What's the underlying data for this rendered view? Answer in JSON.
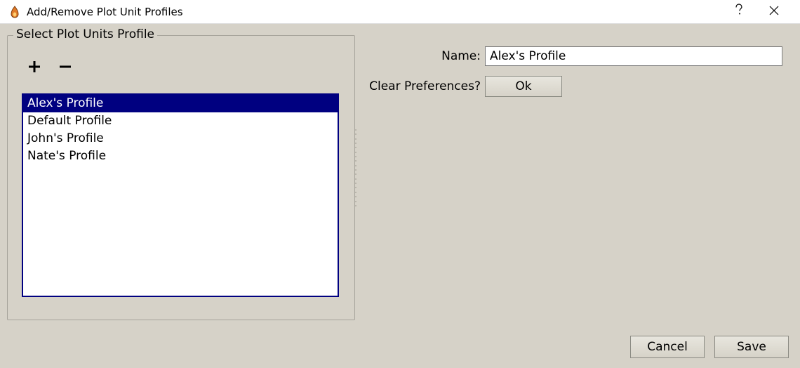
{
  "window": {
    "title": "Add/Remove Plot Unit Profiles"
  },
  "groupbox": {
    "title": "Select Plot Units Profile"
  },
  "profiles": {
    "items": [
      {
        "label": "Alex's Profile",
        "selected": true
      },
      {
        "label": "Default Profile",
        "selected": false
      },
      {
        "label": "John's Profile",
        "selected": false
      },
      {
        "label": "Nate's Profile",
        "selected": false
      }
    ]
  },
  "form": {
    "name_label": "Name:",
    "name_value": "Alex's Profile",
    "clear_label": "Clear Preferences?",
    "ok_label": "Ok"
  },
  "buttons": {
    "cancel": "Cancel",
    "save": "Save"
  }
}
